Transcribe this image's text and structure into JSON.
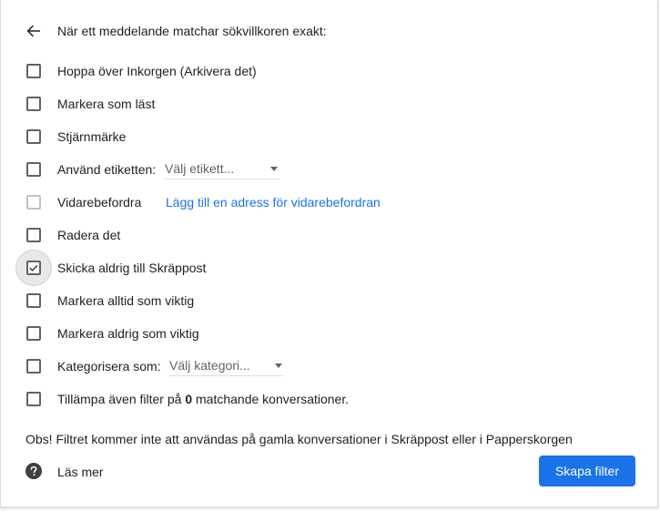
{
  "header": {
    "text": "När ett meddelande matchar sökvillkoren exakt:"
  },
  "options": [
    {
      "label": "Hoppa över Inkorgen (Arkivera det)",
      "checked": false
    },
    {
      "label": "Markera som läst",
      "checked": false
    },
    {
      "label": "Stjärnmärke",
      "checked": false
    },
    {
      "label": "Använd etiketten:",
      "checked": false,
      "select_value": "Välj etikett..."
    },
    {
      "label": "Vidarebefordra",
      "checked": false,
      "disabled": true,
      "link": "Lägg till en adress för vidarebefordran"
    },
    {
      "label": "Radera det",
      "checked": false
    },
    {
      "label": "Skicka aldrig till Skräppost",
      "checked": true,
      "focused": true
    },
    {
      "label": "Markera alltid som viktig",
      "checked": false
    },
    {
      "label": "Markera aldrig som viktig",
      "checked": false
    },
    {
      "label": "Kategorisera som:",
      "checked": false,
      "select_value": "Välj kategori..."
    },
    {
      "label_prefix": "Tillämpa även filter på ",
      "label_count": "0",
      "label_suffix": " matchande konversationer.",
      "checked": false
    }
  ],
  "note": "Obs! Filtret kommer inte att användas på gamla konversationer i Skräppost eller i Papperskorgen",
  "footer": {
    "learn_more": "Läs mer",
    "create_button": "Skapa filter"
  },
  "icons": {
    "back": "arrow-back-icon",
    "help": "help-circle-icon",
    "check": "checkmark-icon",
    "caret": "caret-down-icon"
  },
  "colors": {
    "accent": "#1a73e8",
    "text": "#202124",
    "secondary": "#5f6368"
  }
}
